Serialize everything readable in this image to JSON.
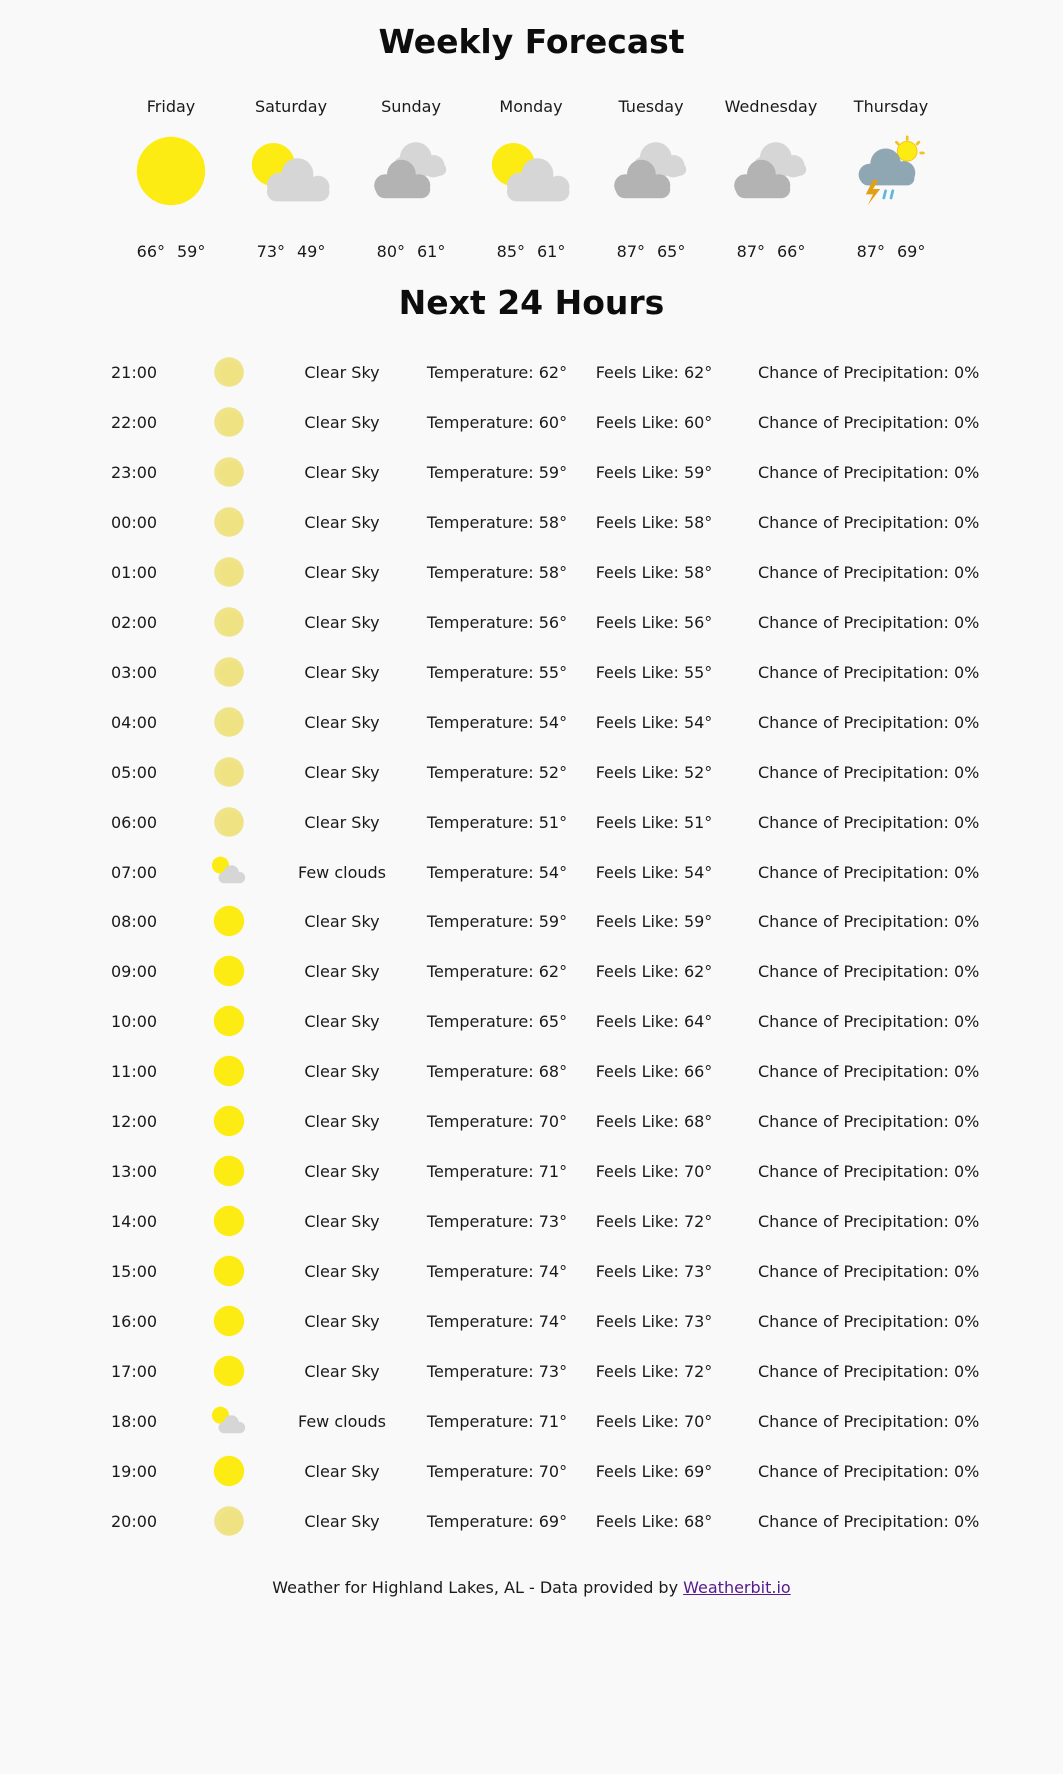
{
  "weekly": {
    "title": "Weekly Forecast",
    "days": [
      {
        "name": "Friday",
        "icon": "sun-icon",
        "high": "66°",
        "low": "59°"
      },
      {
        "name": "Saturday",
        "icon": "partly-cloudy-icon",
        "high": "73°",
        "low": "49°"
      },
      {
        "name": "Sunday",
        "icon": "overcast-clouds-icon",
        "high": "80°",
        "low": "61°"
      },
      {
        "name": "Monday",
        "icon": "partly-cloudy-icon",
        "high": "85°",
        "low": "61°"
      },
      {
        "name": "Tuesday",
        "icon": "overcast-clouds-icon",
        "high": "87°",
        "low": "65°"
      },
      {
        "name": "Wednesday",
        "icon": "overcast-clouds-icon",
        "high": "87°",
        "low": "66°"
      },
      {
        "name": "Thursday",
        "icon": "thunderstorm-icon",
        "high": "87°",
        "low": "69°"
      }
    ]
  },
  "hourly": {
    "title": "Next 24 Hours",
    "rows": [
      {
        "time": "21:00",
        "icon": "moon-icon",
        "desc": "Clear Sky",
        "temp": "Temperature: 62°",
        "feels": "Feels Like: 62°",
        "precip": "Chance of Precipitation: 0%"
      },
      {
        "time": "22:00",
        "icon": "moon-icon",
        "desc": "Clear Sky",
        "temp": "Temperature: 60°",
        "feels": "Feels Like: 60°",
        "precip": "Chance of Precipitation: 0%"
      },
      {
        "time": "23:00",
        "icon": "moon-icon",
        "desc": "Clear Sky",
        "temp": "Temperature: 59°",
        "feels": "Feels Like: 59°",
        "precip": "Chance of Precipitation: 0%"
      },
      {
        "time": "00:00",
        "icon": "moon-icon",
        "desc": "Clear Sky",
        "temp": "Temperature: 58°",
        "feels": "Feels Like: 58°",
        "precip": "Chance of Precipitation: 0%"
      },
      {
        "time": "01:00",
        "icon": "moon-icon",
        "desc": "Clear Sky",
        "temp": "Temperature: 58°",
        "feels": "Feels Like: 58°",
        "precip": "Chance of Precipitation: 0%"
      },
      {
        "time": "02:00",
        "icon": "moon-icon",
        "desc": "Clear Sky",
        "temp": "Temperature: 56°",
        "feels": "Feels Like: 56°",
        "precip": "Chance of Precipitation: 0%"
      },
      {
        "time": "03:00",
        "icon": "moon-icon",
        "desc": "Clear Sky",
        "temp": "Temperature: 55°",
        "feels": "Feels Like: 55°",
        "precip": "Chance of Precipitation: 0%"
      },
      {
        "time": "04:00",
        "icon": "moon-icon",
        "desc": "Clear Sky",
        "temp": "Temperature: 54°",
        "feels": "Feels Like: 54°",
        "precip": "Chance of Precipitation: 0%"
      },
      {
        "time": "05:00",
        "icon": "moon-icon",
        "desc": "Clear Sky",
        "temp": "Temperature: 52°",
        "feels": "Feels Like: 52°",
        "precip": "Chance of Precipitation: 0%"
      },
      {
        "time": "06:00",
        "icon": "moon-icon",
        "desc": "Clear Sky",
        "temp": "Temperature: 51°",
        "feels": "Feels Like: 51°",
        "precip": "Chance of Precipitation: 0%"
      },
      {
        "time": "07:00",
        "icon": "few-clouds-icon",
        "desc": "Few clouds",
        "temp": "Temperature: 54°",
        "feels": "Feels Like: 54°",
        "precip": "Chance of Precipitation: 0%"
      },
      {
        "time": "08:00",
        "icon": "sun-icon",
        "desc": "Clear Sky",
        "temp": "Temperature: 59°",
        "feels": "Feels Like: 59°",
        "precip": "Chance of Precipitation: 0%"
      },
      {
        "time": "09:00",
        "icon": "sun-icon",
        "desc": "Clear Sky",
        "temp": "Temperature: 62°",
        "feels": "Feels Like: 62°",
        "precip": "Chance of Precipitation: 0%"
      },
      {
        "time": "10:00",
        "icon": "sun-icon",
        "desc": "Clear Sky",
        "temp": "Temperature: 65°",
        "feels": "Feels Like: 64°",
        "precip": "Chance of Precipitation: 0%"
      },
      {
        "time": "11:00",
        "icon": "sun-icon",
        "desc": "Clear Sky",
        "temp": "Temperature: 68°",
        "feels": "Feels Like: 66°",
        "precip": "Chance of Precipitation: 0%"
      },
      {
        "time": "12:00",
        "icon": "sun-icon",
        "desc": "Clear Sky",
        "temp": "Temperature: 70°",
        "feels": "Feels Like: 68°",
        "precip": "Chance of Precipitation: 0%"
      },
      {
        "time": "13:00",
        "icon": "sun-icon",
        "desc": "Clear Sky",
        "temp": "Temperature: 71°",
        "feels": "Feels Like: 70°",
        "precip": "Chance of Precipitation: 0%"
      },
      {
        "time": "14:00",
        "icon": "sun-icon",
        "desc": "Clear Sky",
        "temp": "Temperature: 73°",
        "feels": "Feels Like: 72°",
        "precip": "Chance of Precipitation: 0%"
      },
      {
        "time": "15:00",
        "icon": "sun-icon",
        "desc": "Clear Sky",
        "temp": "Temperature: 74°",
        "feels": "Feels Like: 73°",
        "precip": "Chance of Precipitation: 0%"
      },
      {
        "time": "16:00",
        "icon": "sun-icon",
        "desc": "Clear Sky",
        "temp": "Temperature: 74°",
        "feels": "Feels Like: 73°",
        "precip": "Chance of Precipitation: 0%"
      },
      {
        "time": "17:00",
        "icon": "sun-icon",
        "desc": "Clear Sky",
        "temp": "Temperature: 73°",
        "feels": "Feels Like: 72°",
        "precip": "Chance of Precipitation: 0%"
      },
      {
        "time": "18:00",
        "icon": "few-clouds-icon",
        "desc": "Few clouds",
        "temp": "Temperature: 71°",
        "feels": "Feels Like: 70°",
        "precip": "Chance of Precipitation: 0%"
      },
      {
        "time": "19:00",
        "icon": "sun-icon",
        "desc": "Clear Sky",
        "temp": "Temperature: 70°",
        "feels": "Feels Like: 69°",
        "precip": "Chance of Precipitation: 0%"
      },
      {
        "time": "20:00",
        "icon": "moon-icon",
        "desc": "Clear Sky",
        "temp": "Temperature: 69°",
        "feels": "Feels Like: 68°",
        "precip": "Chance of Precipitation: 0%"
      }
    ]
  },
  "footer": {
    "text": "Weather for Highland Lakes, AL - Data provided by ",
    "link_label": "Weatherbit.io"
  },
  "colors": {
    "sun": "#fcec14",
    "moon": "#efe48a",
    "cloud_light": "#d6d6d6",
    "cloud_dark": "#b3b3b3",
    "storm_cloud": "#8fa7b3",
    "bolt": "#e3a012",
    "rain": "#5cb8d8"
  }
}
